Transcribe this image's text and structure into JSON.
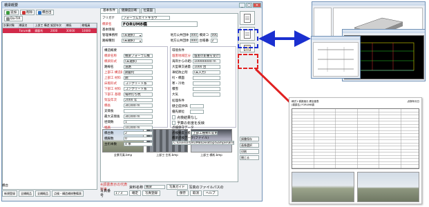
{
  "window": {
    "title": "橋梁概要"
  },
  "toolbar": {
    "add": "追加",
    "delete": "削除",
    "save": "橋台出",
    "filter": "Do-TiR"
  },
  "list": {
    "headers": [
      "計算対象",
      "橋梁名",
      "上部工 構造形式",
      "架設年次",
      "橋長",
      "総幅員"
    ],
    "rows": [
      [
        "",
        "Forum橋",
        "鋼鈑桁",
        "2000",
        "30000",
        "10000"
      ]
    ]
  },
  "left_bottom": {
    "label": "橋台",
    "btn1": "新規登録",
    "btn2": "全橋概品",
    "btn3": "全橋概品",
    "btn4": "点検・構造補修整備表"
  },
  "tabs": [
    "基本条件",
    "健康度診断",
    "位置図"
  ],
  "form": {
    "furigana_label": "フリガナ",
    "furigana_value": "フォーラムエイトキョウ",
    "name_label": "橋梁名",
    "name_value": "FORUM8橋",
    "basic_heading": "基本情報",
    "office_label": "管理事務所",
    "office_value": "(未選択)",
    "route_label": "路線種別",
    "route_value": "(未選択)",
    "pref_label": "地方公共団体コード",
    "pref_value": "000",
    "area_label": "地方公共団体コード",
    "area_value": "000",
    "bridgeid_label": "橋梁コード",
    "bridgeid_value": "000",
    "reg_label": "台帳番号",
    "reg_value": "2",
    "struct_heading": "構造概要",
    "struct_fields": [
      {
        "label": "橋梁名称",
        "value": "橋梁フォーラム橋",
        "red": true
      },
      {
        "label": "橋梁形式",
        "value": "(未選択)",
        "red": true
      },
      {
        "label": "路線名",
        "value": "道路",
        "red": false
      },
      {
        "label": "上部工 構造形式",
        "value": "鋼鈑桁",
        "red": true
      },
      {
        "label": "上部工 材料",
        "value": "鋼",
        "red": true
      },
      {
        "label": "床版形式",
        "value": "コンクリート系",
        "red": true
      },
      {
        "label": "下部工 材料",
        "value": "コンクリート系",
        "red": true
      },
      {
        "label": "下部工 基礎",
        "value": "場所打ち杭",
        "red": true
      },
      {
        "label": "架設年次",
        "value": "2000 年",
        "red": true
      },
      {
        "label": "橋長",
        "value": "30,000 m",
        "red": true
      },
      {
        "label": "支間長",
        "value": "",
        "red": false
      },
      {
        "label": "最大支間長",
        "value": "30,000 m",
        "red": false
      },
      {
        "label": "径間数",
        "value": "1",
        "red": false
      },
      {
        "label": "幅員",
        "value": "10,000 m",
        "red": true
      },
      {
        "label": "橋台数",
        "value": "2",
        "red": false
      },
      {
        "label": "橋脚数",
        "value": "0",
        "red": false
      },
      {
        "label": "主桁本数",
        "value": "4 本",
        "red": false
      }
    ],
    "env_heading": "環境条件",
    "env_fields": [
      {
        "label": "塩害地域区分",
        "value": "塩害の影響を受けない地域",
        "red": true
      },
      {
        "label": "海岸からの距離",
        "value": "100000000 m",
        "red": false
      },
      {
        "label": "大型車交通量",
        "value": "1000 台",
        "red": false
      },
      {
        "label": "凍結防止剤",
        "value": "(未入力)",
        "red": false
      },
      {
        "label": "桁・橋面",
        "value": "",
        "red": false
      },
      {
        "label": "寒・冷地",
        "value": "",
        "red": false
      },
      {
        "label": "積雪",
        "value": "",
        "red": false
      },
      {
        "label": "大気",
        "value": "",
        "red": false
      }
    ],
    "calc_heading": "処理条件",
    "calc_fields": [
      {
        "label": "健全度評価",
        "value": ""
      },
      {
        "label": "優先順位",
        "value": ""
      }
    ],
    "chk1": "点検結果なし",
    "chk2": "予算の年度を反映",
    "note_heading": "点検保守データ",
    "note_label": "点検頻度・積雪頻度等",
    "file_label": "橋梁点検データ(ファイル)",
    "file_path": "C:\\Users\\FORUM8\\Desktop\\Sample\\Bridge",
    "btn_file": "上部工種類の変更..."
  },
  "photos": [
    {
      "caption": "全景写真.bmp"
    },
    {
      "caption": "上部工-主桁.bmp"
    },
    {
      "caption": "上部工-横桁.bmp"
    }
  ],
  "photo_footer": {
    "main_label": "※調書表示の代表写真",
    "num_label": "写真番号",
    "num_value": "1 / 3",
    "file_label": "資料名称",
    "file_value": "橋梁",
    "cap_btn": "写真ガイド",
    "hint": "写真の項目を入力後登録ます",
    "confirm": "確定",
    "save": "写真登録",
    "status_label": "写真のファイルパスの位置",
    "ok": "保存",
    "cancel": "取消",
    "help": "ヘルプ"
  },
  "side_small": [
    "調書保存",
    "画像選択",
    "印刷",
    "閉じる"
  ],
  "sheet": {
    "title": "様式1 橋梁諸元 健全度表",
    "subtitle": "(橋梁名) FORUM8橋",
    "right": "点検年月日"
  },
  "colors": {
    "selected_row": "#d22b4a",
    "blue_arrow": "#1a2fd0",
    "red_arrow": "#e02020"
  },
  "icons": [
    "add-icon",
    "delete-icon",
    "save-icon",
    "list-icon",
    "report-icon",
    "cad-icon",
    "close-icon"
  ]
}
